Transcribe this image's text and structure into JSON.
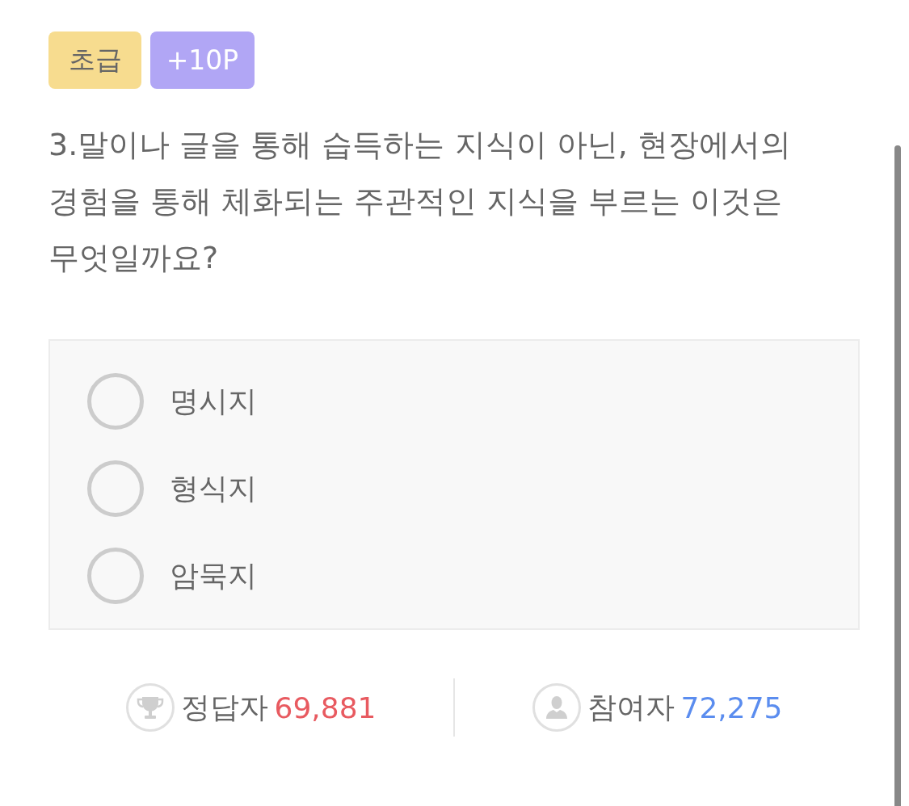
{
  "badges": [
    {
      "kind": "level",
      "label": "초급"
    },
    {
      "kind": "points",
      "label": "+10P"
    }
  ],
  "question": "3.말이나 글을 통해 습득하는 지식이 아닌, 현장에서의 경험을 통해 체화되는 주관적인 지식을 부르는 이것은 무엇일까요?",
  "options": [
    {
      "label": "명시지",
      "selected": false
    },
    {
      "label": "형식지",
      "selected": false
    },
    {
      "label": "암묵지",
      "selected": false
    }
  ],
  "stats": [
    {
      "kind": "correct",
      "label": "정답자",
      "value": "69,881"
    },
    {
      "kind": "participants",
      "label": "참여자",
      "value": "72,275"
    }
  ]
}
